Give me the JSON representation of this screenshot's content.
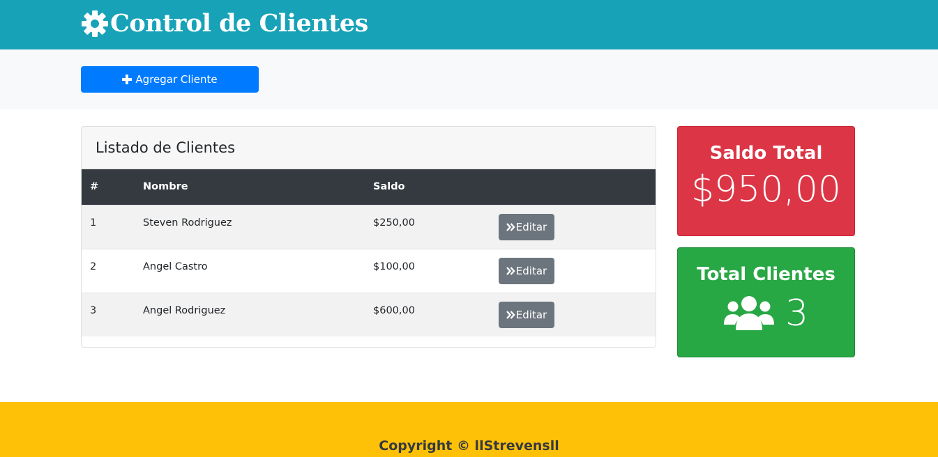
{
  "header": {
    "title": "Control de Clientes",
    "icon": "gear-icon"
  },
  "actions": {
    "add_label": "Agregar Cliente",
    "add_icon": "plus-icon"
  },
  "clients_card": {
    "title": "Listado de Clientes",
    "columns": [
      "#",
      "Nombre",
      "Saldo",
      ""
    ],
    "rows": [
      {
        "num": "1",
        "name": "Steven Rodriguez",
        "saldo": "$250,00",
        "edit_label": "Editar"
      },
      {
        "num": "2",
        "name": "Angel Castro",
        "saldo": "$100,00",
        "edit_label": "Editar"
      },
      {
        "num": "3",
        "name": "Angel Rodriguez",
        "saldo": "$600,00",
        "edit_label": "Editar"
      }
    ]
  },
  "summary": {
    "saldo_title": "Saldo Total",
    "saldo_value": "$950,00",
    "clientes_title": "Total Clientes",
    "clientes_value": "3",
    "clientes_icon": "users-icon"
  },
  "footer": {
    "text": "Copyright © llStrevensll"
  },
  "colors": {
    "header": "#17a2b8",
    "primary": "#007bff",
    "danger": "#dc3545",
    "success": "#28a745",
    "warning": "#ffc107",
    "secondary": "#6c757d",
    "dark": "#343a40"
  }
}
